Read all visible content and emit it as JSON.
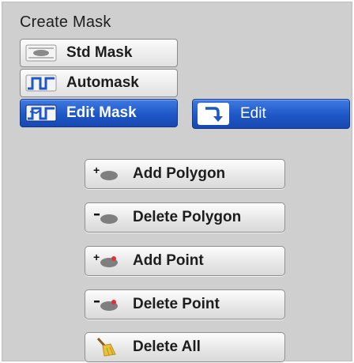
{
  "panel": {
    "title": "Create Mask"
  },
  "modes": [
    {
      "label": "Std Mask",
      "icon": "std-mask-icon"
    },
    {
      "label": "Automask",
      "icon": "automask-waveform-icon"
    },
    {
      "label": "Edit Mask",
      "icon": "edit-mask-waveform-icon",
      "selected": true
    }
  ],
  "edit_button": {
    "label": "Edit",
    "icon": "curved-arrow-icon"
  },
  "actions": [
    {
      "label": "Add Polygon",
      "icon": "add-polygon-icon"
    },
    {
      "label": "Delete Polygon",
      "icon": "delete-polygon-icon"
    },
    {
      "label": "Add Point",
      "icon": "add-point-icon"
    },
    {
      "label": "Delete Point",
      "icon": "delete-point-icon"
    },
    {
      "label": "Delete All",
      "icon": "broom-icon"
    }
  ],
  "colors": {
    "selected_blue": "#1e57c7",
    "panel_gray": "#cfcfcf",
    "point_red": "#e0303a"
  }
}
